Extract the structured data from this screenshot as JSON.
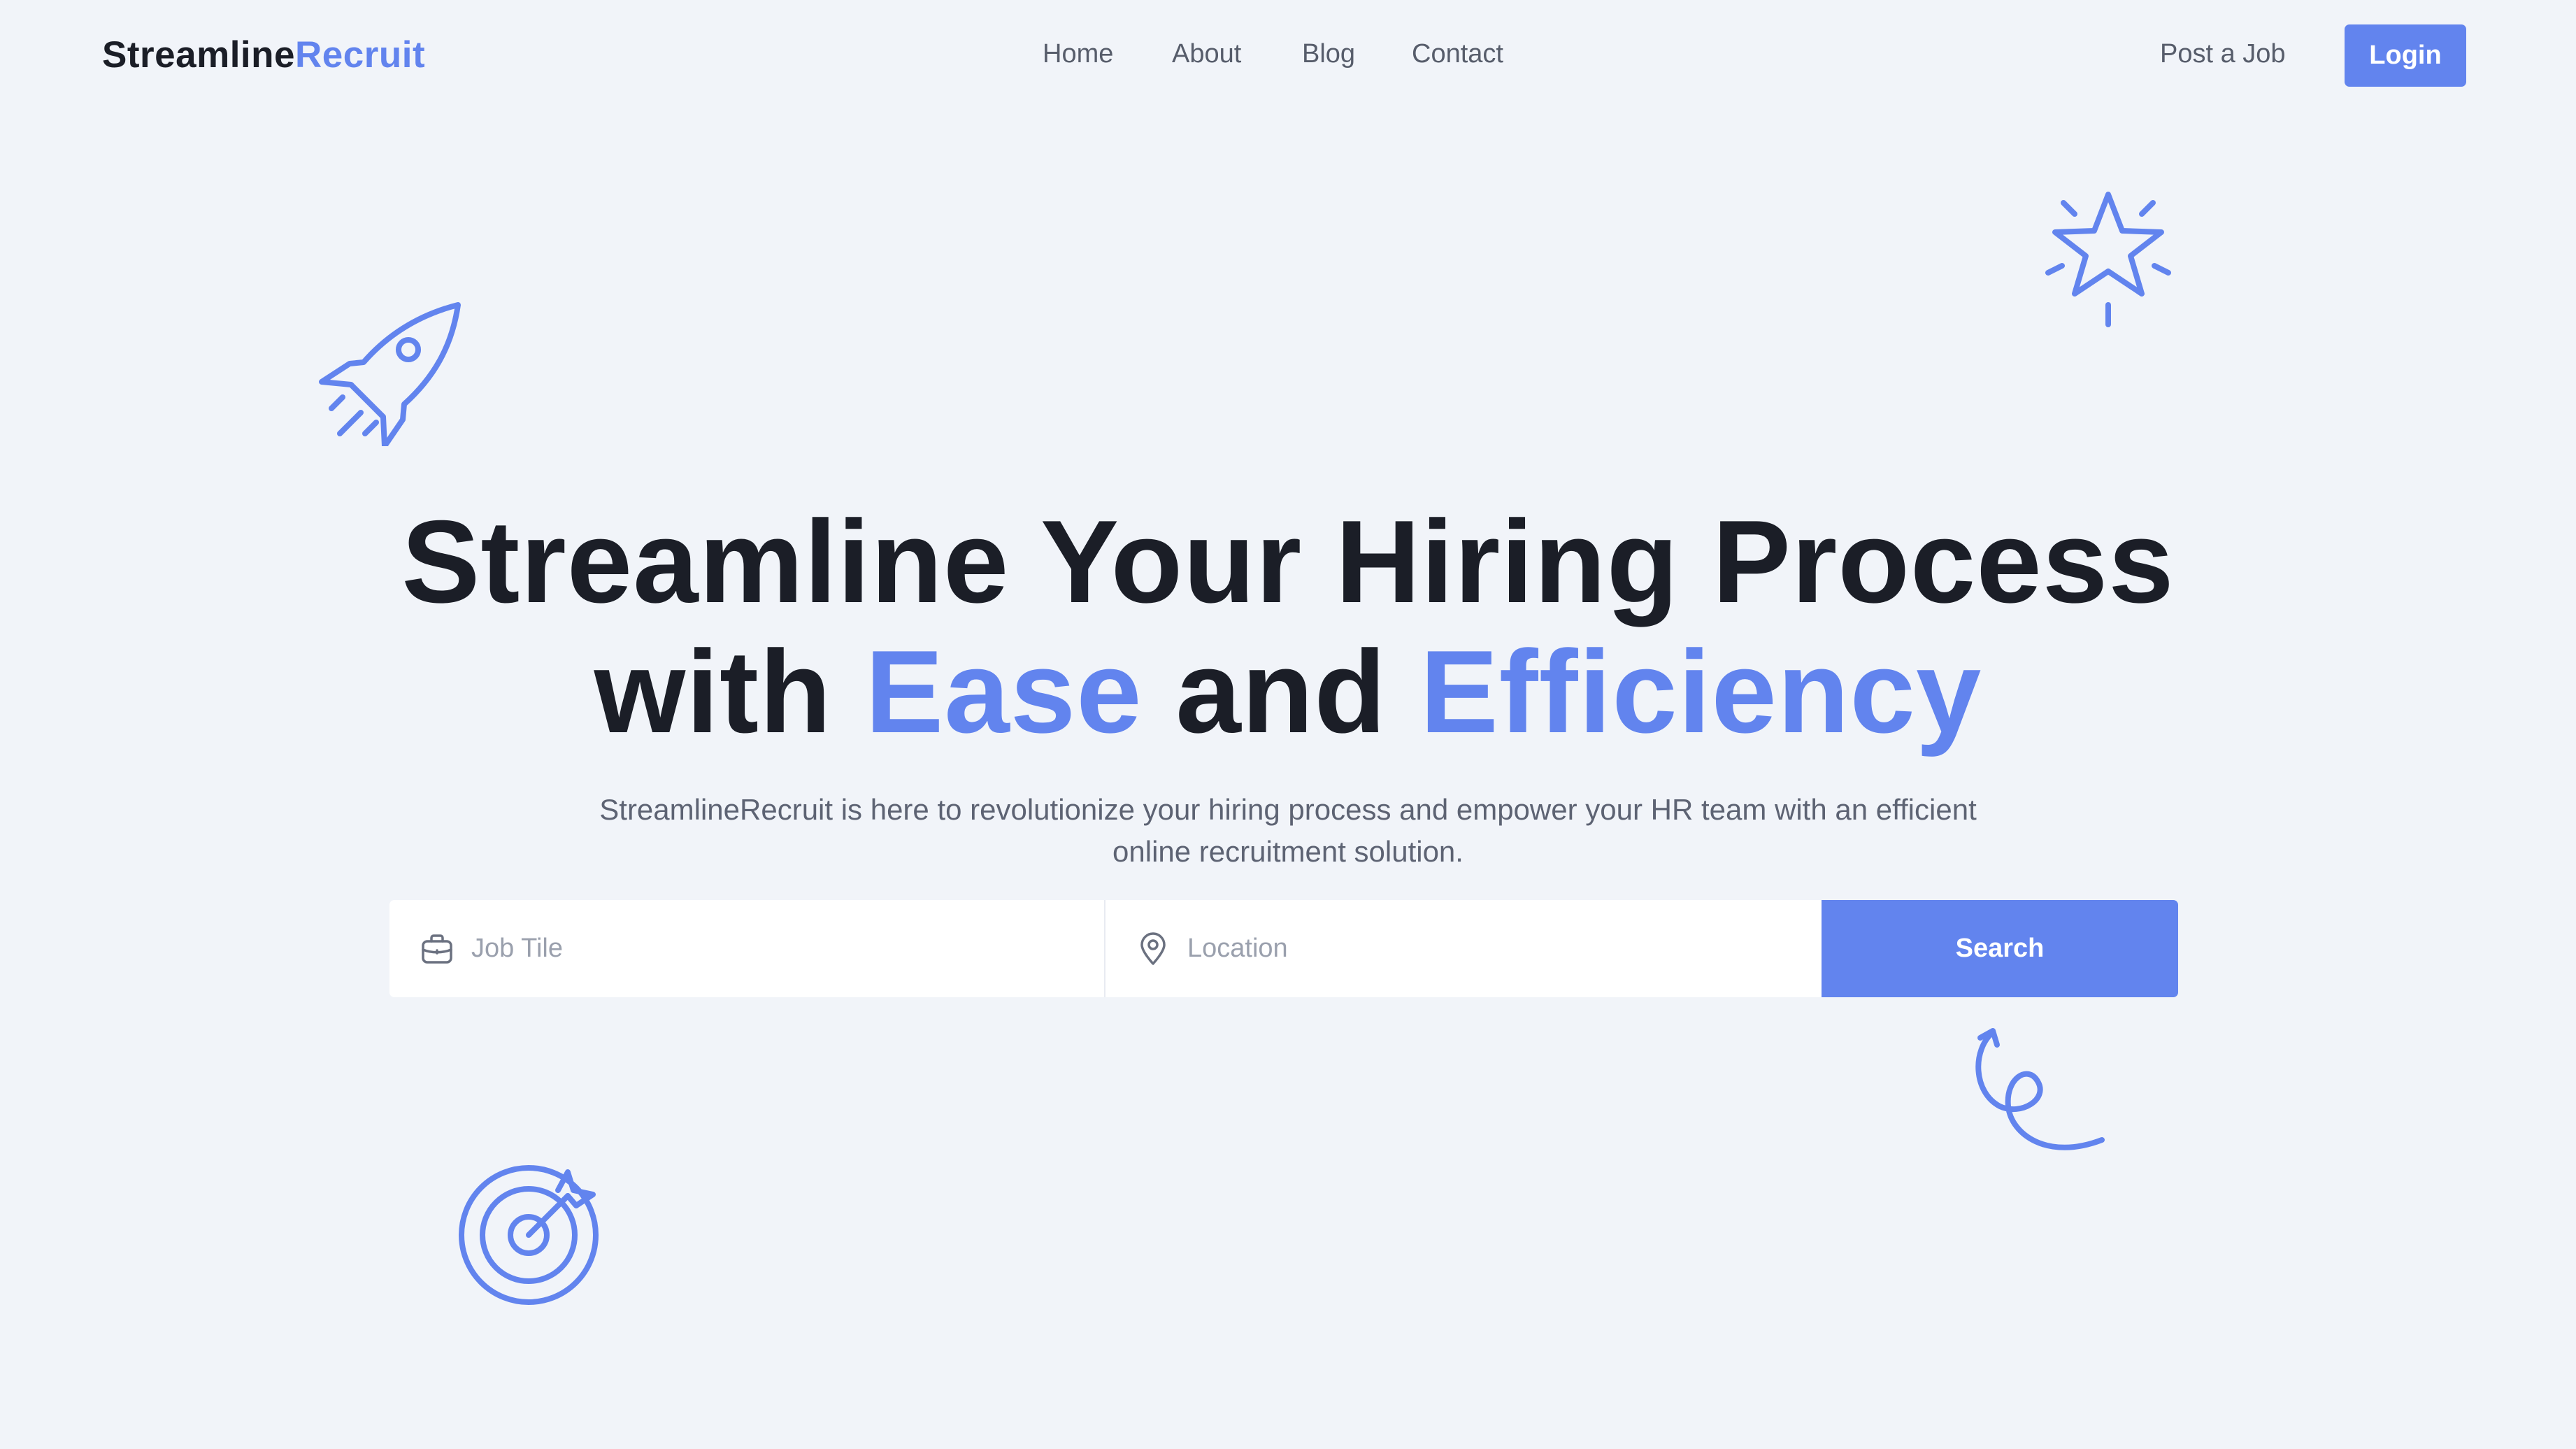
{
  "brand": {
    "name_part1": "Streamline",
    "name_part2": "Recruit",
    "accent_color": "#6284ee"
  },
  "nav": {
    "items": [
      {
        "label": "Home"
      },
      {
        "label": "About"
      },
      {
        "label": "Blog"
      },
      {
        "label": "Contact"
      }
    ]
  },
  "header_actions": {
    "post_job_label": "Post a Job",
    "login_label": "Login"
  },
  "hero": {
    "headline_line1": "Streamline Your Hiring Process",
    "headline_with": "with",
    "headline_highlight1": "Ease",
    "headline_and": "and",
    "headline_highlight2": "Efficiency",
    "subtitle": "StreamlineRecruit is here to revolutionize your hiring process and empower your HR team with an efficient online recruitment solution."
  },
  "search": {
    "job_placeholder": "Job Tile",
    "job_icon": "briefcase-icon",
    "location_placeholder": "Location",
    "location_icon": "map-pin-icon",
    "button_label": "Search"
  },
  "decorations": [
    "rocket-icon",
    "star-icon",
    "swirl-arrow-icon",
    "target-icon"
  ]
}
